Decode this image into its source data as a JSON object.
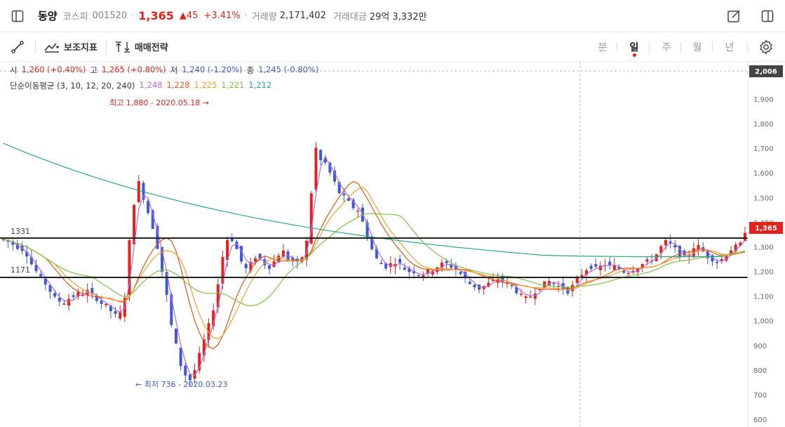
{
  "header": {
    "stock_name": "동양",
    "market": "코스피",
    "code": "001520",
    "price": "1,365",
    "change": "▲45",
    "change_pct": "+3.41%",
    "volume_label": "거래량",
    "volume": "2,171,402",
    "amount_label": "거래대금",
    "amount": "29억 3,332만"
  },
  "toolbar": {
    "indicators_label": "보조지표",
    "strategy_label": "매매전략",
    "periods": [
      "분",
      "일",
      "주",
      "월",
      "년"
    ],
    "active_period": "일"
  },
  "ohlc": {
    "open_label": "시",
    "open": "1,260 (+0.40%)",
    "high_label": "고",
    "high": "1,265 (+0.80%)",
    "low_label": "저",
    "low": "1,240 (-1.20%)",
    "close_label": "종",
    "close": "1,245 (-0.80%)"
  },
  "ma": {
    "label": "단순이동평균 (3, 10, 12, 20, 240)",
    "values": [
      "1,248",
      "1,228",
      "1,225",
      "1,221",
      "1,212"
    ],
    "colors": [
      "#b36ae2",
      "#e8541c",
      "#f0a030",
      "#7ec24a",
      "#2aa58c"
    ]
  },
  "colors": {
    "up": "#e0241d",
    "down": "#3c5ad6",
    "accent": "#e0241d"
  },
  "chart_data": {
    "type": "candlestick",
    "y_ticks": [
      "1,900",
      "1,800",
      "1,700",
      "1,600",
      "1,500",
      "1,400",
      "1,300",
      "1,200",
      "1,100",
      "1,000",
      "900",
      "800",
      "700",
      "600"
    ],
    "ylim": [
      570,
      2030
    ],
    "crosshair_price": "2,006",
    "last_price_tag": "1,365",
    "levels": [
      {
        "label": "1331",
        "value": 1331
      },
      {
        "label": "1171",
        "value": 1171
      }
    ],
    "annotations": [
      {
        "text": "최고 1,880 - 2020.05.18 →",
        "value": 1880
      },
      {
        "text": "← 최저 736 - 2020.03.23",
        "value": 736
      }
    ],
    "close_path": [
      1330,
      1320,
      1310,
      1300,
      1290,
      1270,
      1230,
      1200,
      1170,
      1150,
      1120,
      1090,
      1080,
      1075,
      1090,
      1100,
      1110,
      1110,
      1120,
      1100,
      1090,
      1070,
      1060,
      1040,
      1020,
      1030,
      1100,
      1320,
      1480,
      1560,
      1500,
      1440,
      1380,
      1300,
      1200,
      1100,
      980,
      900,
      820,
      780,
      760,
      800,
      860,
      920,
      980,
      1050,
      1150,
      1260,
      1330,
      1330,
      1290,
      1240,
      1210,
      1230,
      1260,
      1250,
      1230,
      1220,
      1240,
      1270,
      1280,
      1250,
      1240,
      1230,
      1260,
      1320,
      1520,
      1700,
      1650,
      1640,
      1600,
      1560,
      1520,
      1500,
      1480,
      1460,
      1450,
      1400,
      1340,
      1290,
      1250,
      1230,
      1220,
      1230,
      1240,
      1230,
      1210,
      1200,
      1200,
      1190,
      1190,
      1200,
      1210,
      1220,
      1230,
      1230,
      1220,
      1210,
      1190,
      1170,
      1150,
      1140,
      1130,
      1140,
      1150,
      1160,
      1170,
      1160,
      1150,
      1140,
      1120,
      1100,
      1090,
      1100,
      1120,
      1140,
      1150,
      1160,
      1150,
      1140,
      1130,
      1120,
      1140,
      1170,
      1190,
      1210,
      1220,
      1210,
      1220,
      1230,
      1220,
      1220,
      1210,
      1200,
      1200,
      1210,
      1220,
      1230,
      1240,
      1250,
      1270,
      1300,
      1320,
      1310,
      1290,
      1270,
      1250,
      1270,
      1300,
      1300,
      1280,
      1260,
      1250,
      1240,
      1250,
      1270,
      1290,
      1300,
      1310,
      1365
    ]
  }
}
